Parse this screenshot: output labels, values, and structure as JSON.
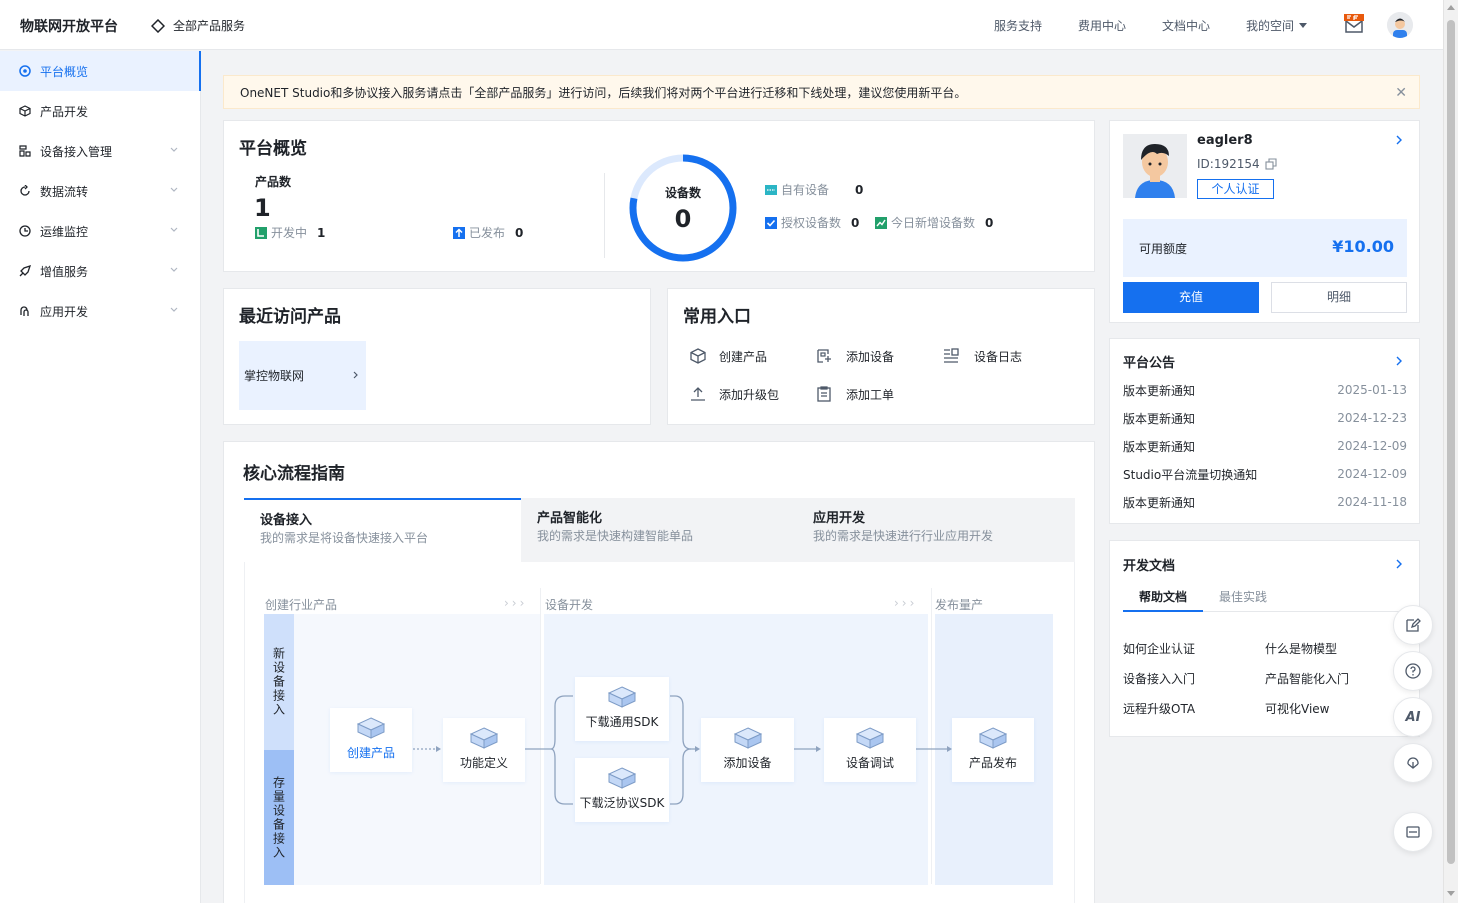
{
  "header": {
    "brand": "物联网开放平台",
    "all_services": "全部产品服务",
    "nav": [
      "服务支持",
      "费用中心",
      "文档中心"
    ],
    "my_space": "我的空间"
  },
  "sidebar": {
    "items": [
      {
        "label": "平台概览",
        "icon": "dashboard-icon",
        "active": true
      },
      {
        "label": "产品开发",
        "icon": "cube-icon"
      },
      {
        "label": "设备接入管理",
        "icon": "device-icon",
        "expandable": true
      },
      {
        "label": "数据流转",
        "icon": "flow-icon",
        "expandable": true
      },
      {
        "label": "运维监控",
        "icon": "monitor-icon",
        "expandable": true
      },
      {
        "label": "增值服务",
        "icon": "rocket-icon",
        "expandable": true
      },
      {
        "label": "应用开发",
        "icon": "app-icon",
        "expandable": true
      }
    ]
  },
  "notice": {
    "text": "OneNET Studio和多协议接入服务请点击「全部产品服务」进行访问，后续我们将对两个平台进行迁移和下线处理，建议您使用新平台。"
  },
  "overview": {
    "title": "平台概览",
    "product_count_label": "产品数",
    "product_count": "1",
    "developing_label": "开发中",
    "developing_count": "1",
    "published_label": "已发布",
    "published_count": "0",
    "device_count_label": "设备数",
    "device_count": "0",
    "own_devices_label": "自有设备",
    "own_devices": "0",
    "authorized_label": "授权设备数",
    "authorized": "0",
    "new_today_label": "今日新增设备数",
    "new_today": "0"
  },
  "recent": {
    "title": "最近访问产品",
    "items": [
      "掌控物联网"
    ]
  },
  "shortcuts": {
    "title": "常用入口",
    "items": [
      {
        "label": "创建产品",
        "icon": "cube-outline-icon"
      },
      {
        "label": "添加设备",
        "icon": "add-device-icon"
      },
      {
        "label": "设备日志",
        "icon": "log-icon"
      },
      {
        "label": "添加升级包",
        "icon": "upload-icon"
      },
      {
        "label": "添加工单",
        "icon": "ticket-icon"
      }
    ]
  },
  "guide": {
    "title": "核心流程指南",
    "tabs": [
      {
        "title": "设备接入",
        "desc": "我的需求是将设备快速接入平台",
        "active": true
      },
      {
        "title": "产品智能化",
        "desc": "我的需求是快速构建智能单品"
      },
      {
        "title": "应用开发",
        "desc": "我的需求是快速进行行业应用开发"
      }
    ],
    "stages": [
      "创建行业产品",
      "设备开发",
      "发布量产"
    ],
    "lanes": [
      "新设备接入",
      "存量设备接入"
    ],
    "nodes": {
      "create": "创建产品",
      "define": "功能定义",
      "sdk_general": "下载通用SDK",
      "sdk_multi": "下载泛协议SDK",
      "add_device": "添加设备",
      "debug": "设备调试",
      "publish": "产品发布"
    }
  },
  "user": {
    "name": "eagler8",
    "id": "ID:192154",
    "verify": "个人认证",
    "credit_label": "可用额度",
    "credit": "¥10.00",
    "recharge": "充值",
    "detail": "明细"
  },
  "announcements": {
    "title": "平台公告",
    "items": [
      {
        "title": "版本更新通知",
        "date": "2025-01-13"
      },
      {
        "title": "版本更新通知",
        "date": "2024-12-23"
      },
      {
        "title": "版本更新通知",
        "date": "2024-12-09"
      },
      {
        "title": "Studio平台流量切换通知",
        "date": "2024-12-09"
      },
      {
        "title": "版本更新通知",
        "date": "2024-11-18"
      }
    ]
  },
  "docs": {
    "title": "开发文档",
    "tabs": [
      "帮助文档",
      "最佳实践"
    ],
    "links": [
      "如何企业认证",
      "什么是物模型",
      "设备接入入门",
      "产品智能化入门",
      "远程升级OTA",
      "可视化View"
    ]
  },
  "float_tools": {
    "ai_label": "AI"
  },
  "colors": {
    "accent": "#1570ef",
    "notice_bg": "#fff8ec",
    "active_bg": "#eaf2ff"
  }
}
